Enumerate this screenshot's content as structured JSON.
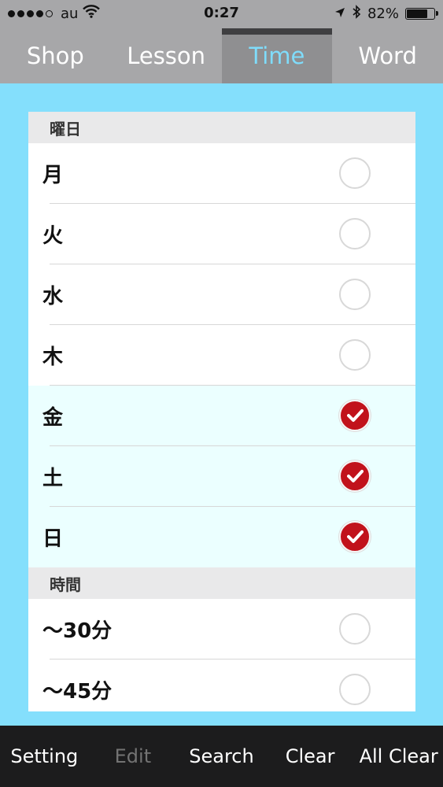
{
  "status_bar": {
    "carrier": "au",
    "time": "0:27",
    "battery_text": "82%",
    "battery_level": 0.82,
    "signal_bars_filled": 4,
    "signal_bars_total": 5
  },
  "tabs": [
    {
      "label": "Shop",
      "active": false
    },
    {
      "label": "Lesson",
      "active": false
    },
    {
      "label": "Time",
      "active": true
    },
    {
      "label": "Word",
      "active": false
    }
  ],
  "sections": [
    {
      "header": "曜日",
      "rows": [
        {
          "label": "月",
          "checked": false
        },
        {
          "label": "火",
          "checked": false
        },
        {
          "label": "水",
          "checked": false
        },
        {
          "label": "木",
          "checked": false
        },
        {
          "label": "金",
          "checked": true
        },
        {
          "label": "土",
          "checked": true
        },
        {
          "label": "日",
          "checked": true
        }
      ]
    },
    {
      "header": "時間",
      "rows": [
        {
          "label": "〜30分",
          "checked": false
        },
        {
          "label": "〜45分",
          "checked": false
        }
      ]
    }
  ],
  "toolbar": {
    "setting": "Setting",
    "edit": "Edit",
    "search": "Search",
    "clear": "Clear",
    "all_clear": "All Clear"
  },
  "colors": {
    "background": "#84dffc",
    "active_tab_text": "#7fdcfb",
    "check_red": "#c1121b",
    "selected_row": "#ebffff"
  }
}
